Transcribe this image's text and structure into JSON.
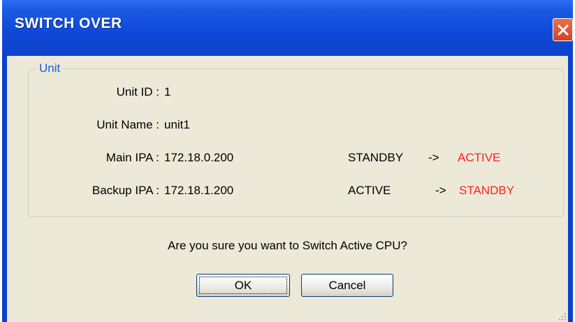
{
  "dialog": {
    "title": "SWITCH OVER",
    "question": "Are you sure you want to Switch Active CPU?",
    "ok_label": "OK",
    "cancel_label": "Cancel"
  },
  "unit": {
    "group_label": "Unit",
    "unit_id_label": "Unit ID :",
    "unit_id_value": "1",
    "unit_name_label": "Unit Name :",
    "unit_name_value": "unit1",
    "main_ipa_label": "Main IPA :",
    "main_ipa_value": "172.18.0.200",
    "main_from": "STANDBY",
    "main_arrow": "->",
    "main_to": "ACTIVE",
    "backup_ipa_label": "Backup IPA :",
    "backup_ipa_value": "172.18.1.200",
    "backup_from": "ACTIVE",
    "backup_arrow": "->",
    "backup_to": "STANDBY"
  },
  "colors": {
    "title_bar": "#0d43cc",
    "client_bg": "#ece9d8",
    "group_label": "#1a5ce0",
    "target_state": "#ff2020"
  }
}
